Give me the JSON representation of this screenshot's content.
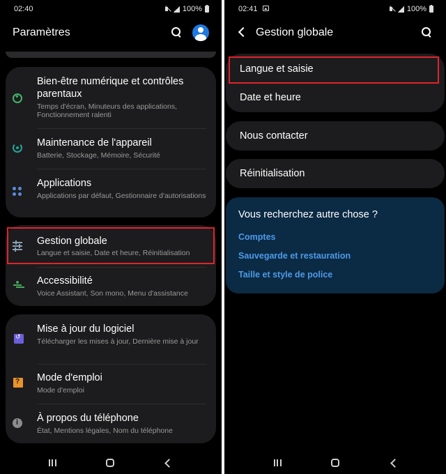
{
  "left_screen": {
    "status_bar": {
      "time": "02:40",
      "battery": "100%"
    },
    "app_bar": {
      "title": "Paramètres"
    },
    "items": [
      {
        "title": "Bien-être numérique et contrôles parentaux",
        "subtitle": "Temps d'écran, Minuteurs des applications, Fonctionnement ralenti",
        "icon": "wellbeing-icon"
      },
      {
        "title": "Maintenance de l'appareil",
        "subtitle": "Batterie, Stockage, Mémoire, Sécurité",
        "icon": "device-care-icon"
      },
      {
        "title": "Applications",
        "subtitle": "Applications par défaut, Gestionnaire d'autorisations",
        "icon": "apps-icon"
      },
      {
        "title": "Gestion globale",
        "subtitle": "Langue et saisie, Date et heure, Réinitialisation",
        "icon": "sliders-icon"
      },
      {
        "title": "Accessibilité",
        "subtitle": "Voice Assistant, Son mono, Menu d'assistance",
        "icon": "accessibility-icon"
      },
      {
        "title": "Mise à jour du logiciel",
        "subtitle": "Télécharger les mises à jour, Dernière mise à jour",
        "icon": "software-update-icon"
      },
      {
        "title": "Mode d'emploi",
        "subtitle": "Mode d'emploi",
        "icon": "user-manual-icon"
      },
      {
        "title": "À propos du téléphone",
        "subtitle": "État, Mentions légales, Nom du téléphone",
        "icon": "info-icon"
      }
    ]
  },
  "right_screen": {
    "status_bar": {
      "time": "02:41",
      "battery": "100%"
    },
    "app_bar": {
      "title": "Gestion globale"
    },
    "items": [
      "Langue et saisie",
      "Date et heure",
      "Nous contacter",
      "Réinitialisation"
    ],
    "suggestions": {
      "heading": "Vous recherchez autre chose ?",
      "links": [
        "Comptes",
        "Sauvegarde et restauration",
        "Taille et style de police"
      ]
    }
  },
  "colors": {
    "highlight": "#e0242b",
    "link": "#4d9ae8",
    "card": "#1c1c1e",
    "suggestion_card": "#0b2a44",
    "avatar": "#1f7ae0"
  }
}
